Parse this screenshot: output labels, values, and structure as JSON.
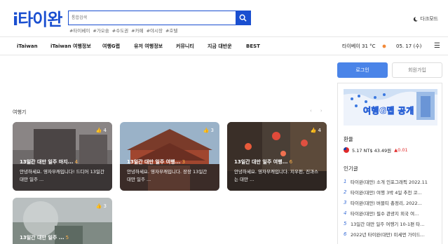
{
  "header": {
    "logo": "i타이완",
    "search_placeholder": "통합검색",
    "tags": [
      "#타이베이",
      "#가오슝",
      "#수도권",
      "#카페",
      "#야시장",
      "#호텔"
    ],
    "dark_mode_label": "다크모드"
  },
  "nav": {
    "items": [
      "iTaiwan",
      "iTaiwan 여행정보",
      "여행G랩",
      "유저 여행정보",
      "커뮤니티",
      "지금 대반운",
      "BEST"
    ],
    "weather": "타이베이 31 °C",
    "date": "05. 17 (수)"
  },
  "main": {
    "section_title": "여행기",
    "cards": [
      {
        "title": "13일간 대만 일주 마지...",
        "count": "4",
        "likes": "4",
        "desc": "안녕하세요. 영자부캐입니다! 드디어 13일간 대만 일주 ..."
      },
      {
        "title": "13일간 대만 일주 여행...",
        "count": "3",
        "likes": "3",
        "desc": "안녕하세요. 영자부캐입니다. 장장 13일간 대만 일주 ..."
      },
      {
        "title": "13일간 대만 일주 여행...",
        "count": "6",
        "likes": "4",
        "desc": "안녕하세요. 영자부캐입니다. 지우펀, 진과스는 대만 ..."
      },
      {
        "title": "13일간 대만 일주 ...",
        "count": "5",
        "likes": "3",
        "desc": ""
      }
    ]
  },
  "sidebar": {
    "login": "로그인",
    "signup": "회원가입",
    "banner_text": "여행G맵 공개",
    "exchange_title": "환율",
    "exchange_value": "5.17 NT$ 43.49원",
    "exchange_change": "▲0.01",
    "popular_title": "인기글",
    "popular": [
      {
        "num": "1",
        "text": "타이완(대만) 소개 인포그래픽 2022.11"
      },
      {
        "num": "2",
        "text": "타이완(대만) 여행 3박 4일 추천 코..."
      },
      {
        "num": "3",
        "text": "타이완(대만) 버블티 총정리, 2022..."
      },
      {
        "num": "4",
        "text": "타이완(대만) 필수 관광지 외국 여..."
      },
      {
        "num": "5",
        "text": "13일간 대만 일주 여행기 10-1편 타..."
      },
      {
        "num": "6",
        "text": "2022년 타이완(대만) 미세먼 가이드..."
      }
    ]
  },
  "colors": {
    "brand": "#1a4fd0",
    "login": "#4a84e8",
    "up": "#e02a2a"
  }
}
